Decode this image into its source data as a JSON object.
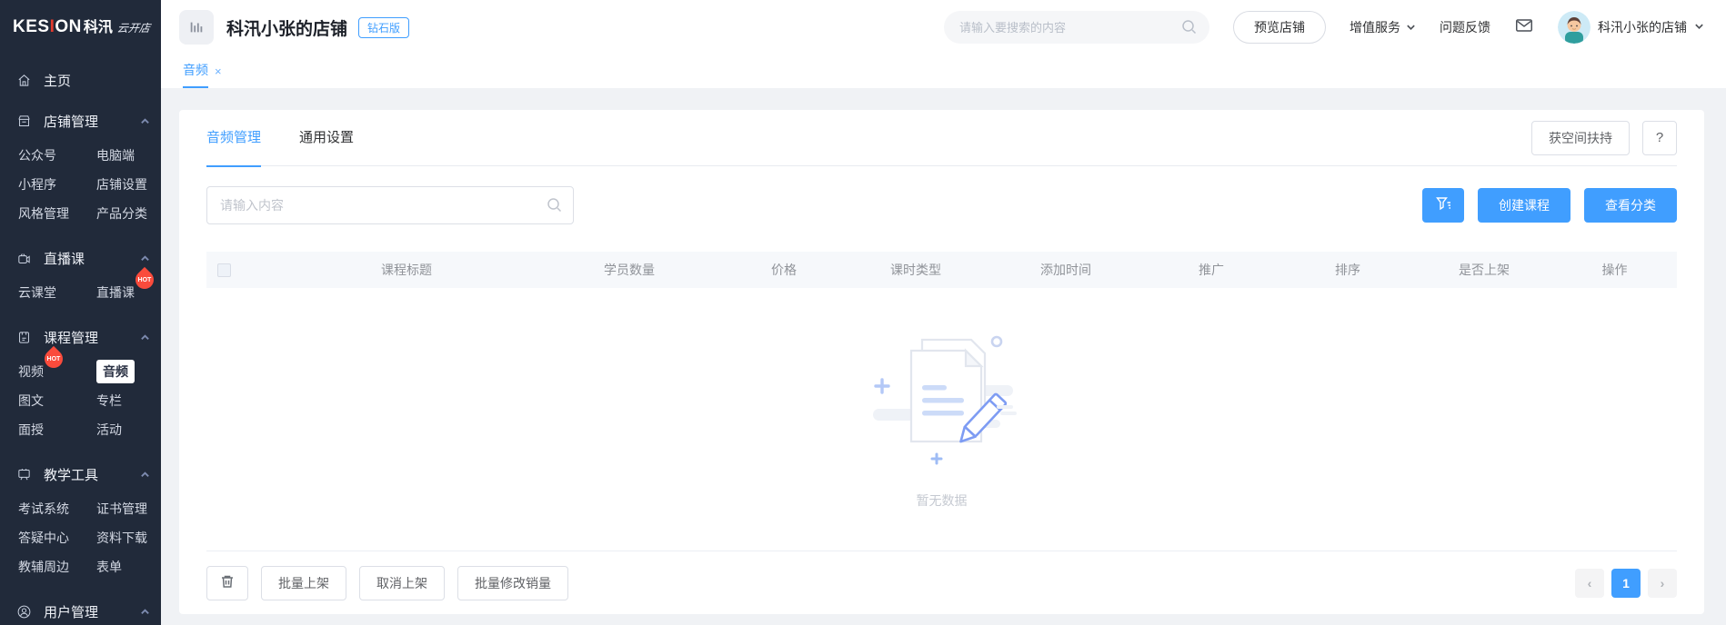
{
  "colors": {
    "accent": "#409EFF",
    "sidebar_bg": "#212A3A",
    "hot": "#FA4B3C"
  },
  "logo": {
    "name_left": "KES",
    "name_accent": "I",
    "name_right": "ON",
    "cn": "科汛",
    "script": "云开店"
  },
  "sidebar": {
    "home": "主页",
    "hot_badge": "HOT",
    "sections": [
      {
        "label": "店铺管理",
        "rows": [
          {
            "l": "公众号",
            "r": "电脑端"
          },
          {
            "l": "小程序",
            "r": "店铺设置"
          },
          {
            "l": "风格管理",
            "r": "产品分类"
          }
        ]
      },
      {
        "label": "直播课",
        "rows": [
          {
            "l": "云课堂",
            "r": "直播课"
          }
        ]
      },
      {
        "label": "课程管理",
        "rows": [
          {
            "l": "视频",
            "r": "音频"
          },
          {
            "l": "图文",
            "r": "专栏"
          },
          {
            "l": "面授",
            "r": "活动"
          }
        ]
      },
      {
        "label": "教学工具",
        "rows": [
          {
            "l": "考试系统",
            "r": "证书管理"
          },
          {
            "l": "答疑中心",
            "r": "资料下载"
          },
          {
            "l": "教辅周边",
            "r": "表单"
          }
        ]
      },
      {
        "label": "用户管理",
        "rows": []
      }
    ]
  },
  "header": {
    "store_name": "科汛小张的店铺",
    "plan_badge": "钻石版",
    "search_placeholder": "请输入要搜索的内容",
    "preview_button": "预览店铺",
    "value_services": "增值服务",
    "feedback": "问题反馈",
    "account_name": "科汛小张的店铺"
  },
  "tabbar": {
    "active_tab": "音频",
    "close": "×"
  },
  "main": {
    "tabs": {
      "manage": "音频管理",
      "settings": "通用设置"
    },
    "support_button": "获空间扶持",
    "help_button": "?",
    "search_placeholder": "请输入内容",
    "create_button": "创建课程",
    "category_button": "查看分类",
    "columns": [
      "课程标题",
      "学员数量",
      "价格",
      "课时类型",
      "添加时间",
      "推广",
      "排序",
      "是否上架",
      "操作"
    ],
    "empty_text": "暂无数据",
    "bulk": {
      "publish": "批量上架",
      "unpublish": "取消上架",
      "edit_sales": "批量修改销量"
    },
    "pagination": {
      "prev": "‹",
      "current": "1",
      "next": "›"
    }
  }
}
